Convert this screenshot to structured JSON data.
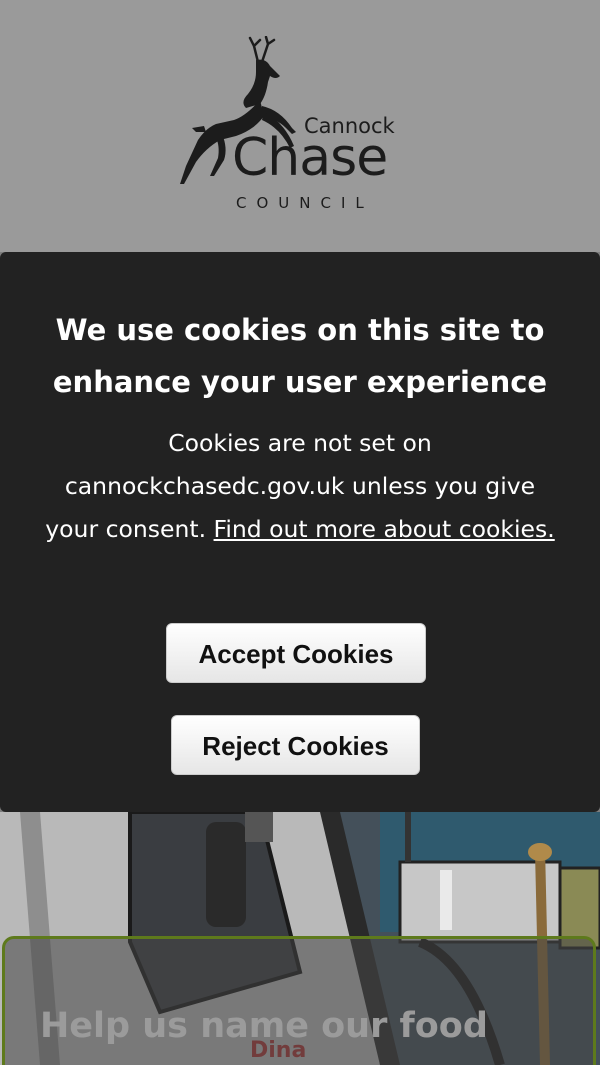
{
  "header": {
    "logo": {
      "line1": "Cannock",
      "line2": "Chase",
      "line3": "COUNCIL"
    }
  },
  "cookie_banner": {
    "title": "We use cookies on this site to enhance your user experience",
    "body_text": "Cookies are not set on cannockchasedc.gov.uk unless you give your consent.",
    "link_text": "Find out more about cookies.",
    "accept_label": "Accept Cookies",
    "reject_label": "Reject Cookies"
  },
  "promo": {
    "title": "Help us name our food"
  },
  "colors": {
    "banner_bg": "#222222",
    "card_border": "#5e7a1c",
    "header_bg": "#9a9a9a"
  }
}
